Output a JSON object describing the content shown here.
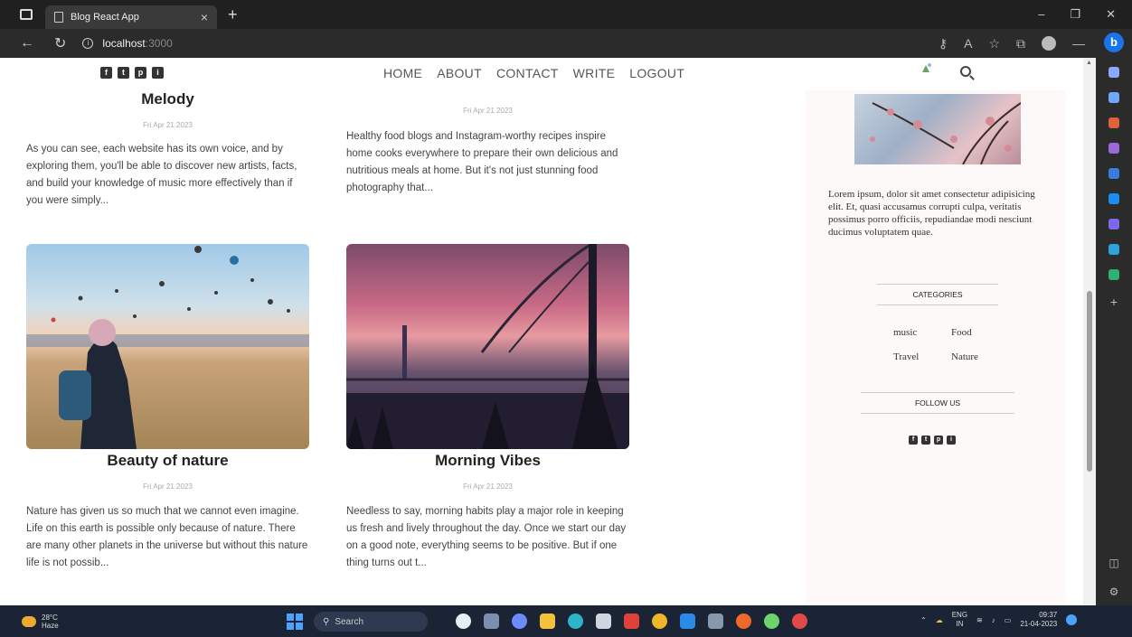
{
  "browser": {
    "tab_title": "Blog React App",
    "new_tab": "+",
    "close_tab": "×",
    "url_host": "localhost",
    "url_port": ":3000"
  },
  "nav": {
    "menu": [
      "HOME",
      "ABOUT",
      "CONTACT",
      "WRITE",
      "LOGOUT"
    ],
    "social": [
      "f",
      "t",
      "p",
      "i"
    ]
  },
  "posts": [
    {
      "title": "Melody",
      "date": "Fri Apr 21 2023",
      "desc": "As you can see, each website has its own voice, and by exploring them, you'll be able to discover new artists, facts, and build your knowledge of music more effectively than if you were simply..."
    },
    {
      "title": "",
      "date": "Fri Apr 21 2023",
      "desc": "Healthy food blogs and Instagram-worthy recipes inspire home cooks everywhere to prepare their own delicious and nutritious meals at home. But it's not just stunning food photography that..."
    },
    {
      "title": "Beauty of nature",
      "date": "Fri Apr 21 2023",
      "desc": "Nature has given us so much that we cannot even imagine. Life on this earth is possible only because of nature. There are many other planets in the universe but without this nature life is not possib..."
    },
    {
      "title": "Morning Vibes",
      "date": "Fri Apr 21 2023",
      "desc": "Needless to say, morning habits play a major role in keeping us fresh and lively throughout the day. Once we start our day on a good note, everything seems to be positive. But if one thing turns out t..."
    }
  ],
  "sidebar": {
    "about": "Lorem ipsum, dolor sit amet consectetur adipisicing elit. Et, quasi accusamus corrupti culpa, veritatis possimus porro officiis, repudiandae modi nesciunt ducimus voluptatem quae.",
    "categories_heading": "CATEGORIES",
    "categories": [
      "music",
      "Food",
      "Travel",
      "Nature"
    ],
    "follow_heading": "FOLLOW US"
  },
  "taskbar": {
    "temp": "28°C",
    "condition": "Haze",
    "search": "Search",
    "lang_top": "ENG",
    "lang_bottom": "IN",
    "time": "09:37",
    "date": "21-04-2023"
  }
}
